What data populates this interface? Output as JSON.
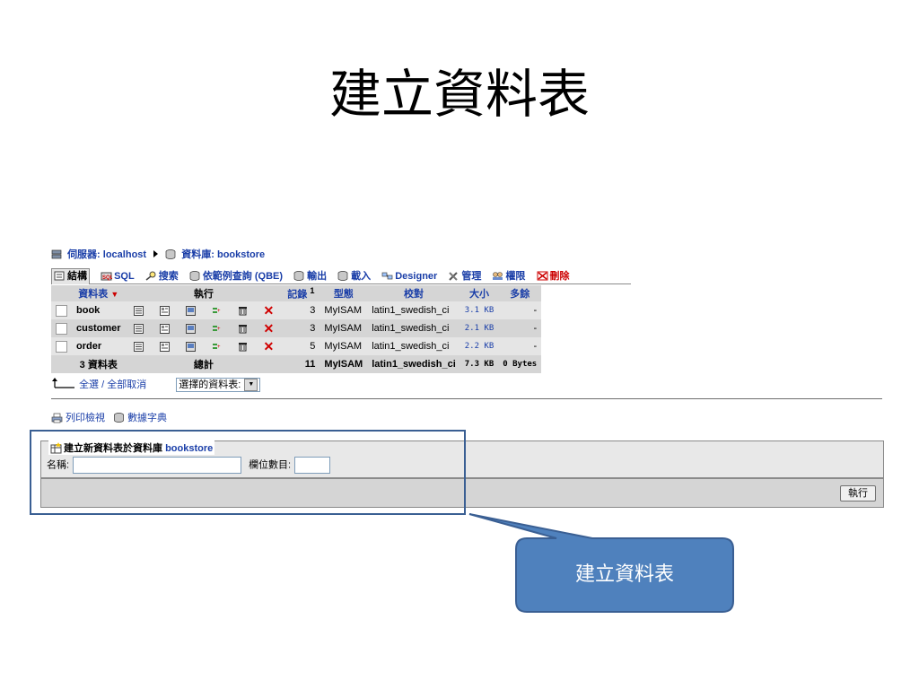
{
  "slide": {
    "title": "建立資料表"
  },
  "breadcrumb": {
    "server": "伺服器: localhost",
    "database": "資料庫: bookstore"
  },
  "tabs": [
    "結構",
    "SQL",
    "搜索",
    "依範例查詢 (QBE)",
    "輸出",
    "載入",
    "Designer",
    "管理",
    "權限",
    "刪除"
  ],
  "table": {
    "headers": {
      "table": "資料表",
      "action": "執行",
      "records": "記錄",
      "records_sup": "1",
      "type": "型態",
      "collation": "校對",
      "size": "大小",
      "overhead": "多餘"
    },
    "rows": [
      {
        "name": "book",
        "records": "3",
        "type": "MyISAM",
        "collation": "latin1_swedish_ci",
        "size": "3.1 KB",
        "overhead": "-"
      },
      {
        "name": "customer",
        "records": "3",
        "type": "MyISAM",
        "collation": "latin1_swedish_ci",
        "size": "2.1 KB",
        "overhead": "-"
      },
      {
        "name": "order",
        "records": "5",
        "type": "MyISAM",
        "collation": "latin1_swedish_ci",
        "size": "2.2 KB",
        "overhead": "-"
      }
    ],
    "total": {
      "name": "3 資料表",
      "label": "總計",
      "records": "11",
      "type": "MyISAM",
      "collation": "latin1_swedish_ci",
      "size": "7.3 KB",
      "overhead": "0 Bytes"
    }
  },
  "bulk": {
    "check_all": "全選 / 全部取消",
    "with_selected": "選擇的資料表:"
  },
  "links": {
    "print_view": "列印檢視",
    "data_dictionary": "數據字典"
  },
  "create_form": {
    "legend": "建立新資料表於資料庫",
    "db_name": "bookstore",
    "name_label": "名稱:",
    "fields_label": "欄位數目:",
    "name_value": "",
    "fields_value": "",
    "go_label": "執行"
  },
  "callout": {
    "text": "建立資料表"
  },
  "colors": {
    "link": "#1a3ea8",
    "callout_fill": "#4f81bd",
    "callout_border": "#3a5f93",
    "delete": "#d00000"
  }
}
